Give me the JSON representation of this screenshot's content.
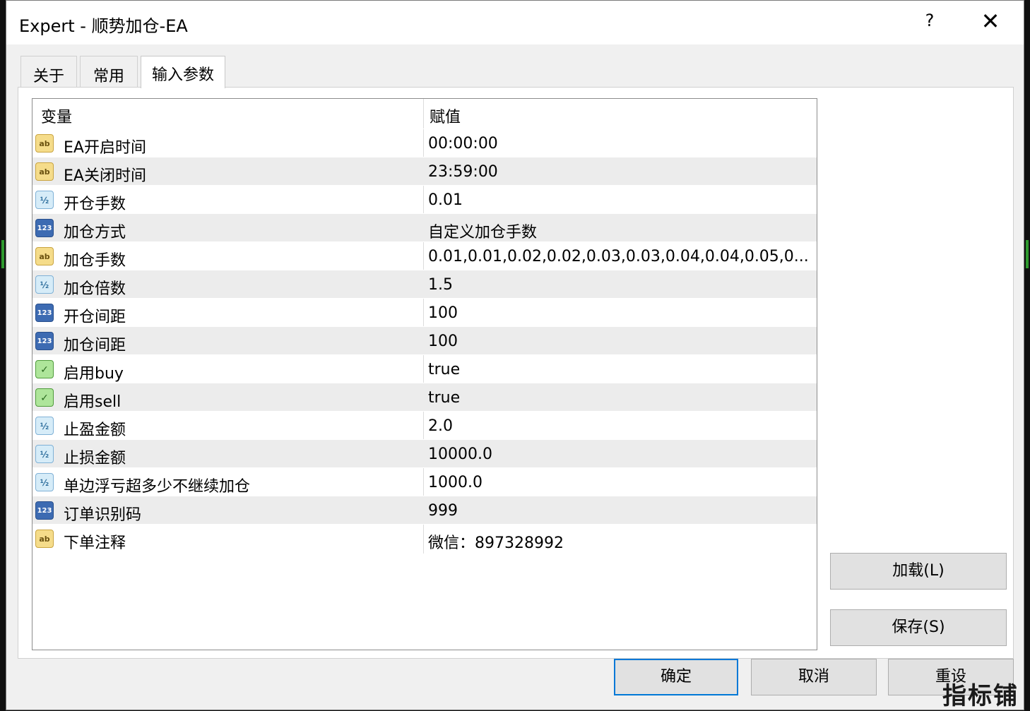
{
  "window": {
    "title": "Expert - 顺势加仓-EA",
    "help_label": "?",
    "close_label": "✕"
  },
  "tabs": [
    {
      "label": "关于"
    },
    {
      "label": "常用"
    },
    {
      "label": "输入参数"
    }
  ],
  "table": {
    "headers": {
      "variable": "变量",
      "value": "赋值"
    },
    "rows": [
      {
        "icon": "ab",
        "name": "EA开启时间",
        "value": "00:00:00"
      },
      {
        "icon": "ab",
        "name": "EA关闭时间",
        "value": "23:59:00"
      },
      {
        "icon": "½",
        "name": "开仓手数",
        "value": "0.01"
      },
      {
        "icon": "123",
        "name": "加仓方式",
        "value": "自定义加仓手数"
      },
      {
        "icon": "ab",
        "name": "加仓手数",
        "value": "0.01,0.01,0.02,0.02,0.03,0.03,0.04,0.04,0.05,0..."
      },
      {
        "icon": "½",
        "name": "加仓倍数",
        "value": "1.5"
      },
      {
        "icon": "123",
        "name": "开仓间距",
        "value": "100"
      },
      {
        "icon": "123",
        "name": "加仓间距",
        "value": "100"
      },
      {
        "icon": "✓",
        "name": "启用buy",
        "value": "true"
      },
      {
        "icon": "✓",
        "name": "启用sell",
        "value": "true"
      },
      {
        "icon": "½",
        "name": "止盈金额",
        "value": "2.0"
      },
      {
        "icon": "½",
        "name": "止损金额",
        "value": "10000.0"
      },
      {
        "icon": "½",
        "name": "单边浮亏超多少不继续加仓",
        "value": "1000.0"
      },
      {
        "icon": "123",
        "name": "订单识别码",
        "value": "999"
      },
      {
        "icon": "ab",
        "name": "下单注释",
        "value": "微信：897328992"
      }
    ]
  },
  "side_buttons": {
    "load": "加载(L)",
    "save": "保存(S)"
  },
  "bottom_buttons": {
    "ok": "确定",
    "cancel": "取消",
    "reset": "重设"
  },
  "watermark": "指标铺"
}
